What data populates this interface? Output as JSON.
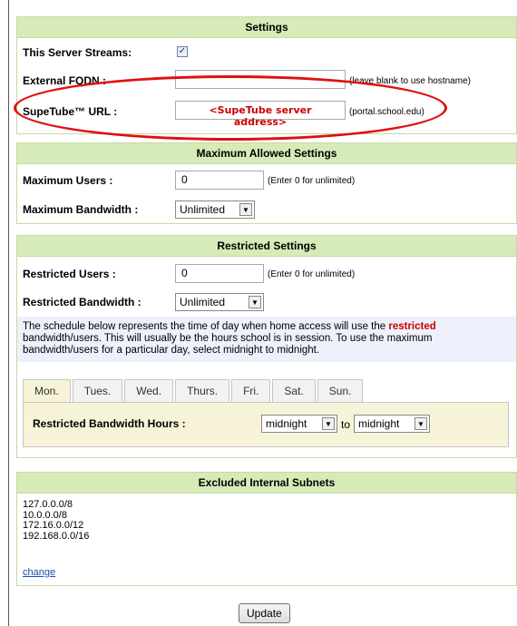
{
  "settings": {
    "header": "Settings",
    "streams_label": "This Server Streams:",
    "streams_checked": true,
    "fqdn_label": "External FQDN :",
    "fqdn_value": "",
    "fqdn_hint": "(leave blank to use hostname)",
    "url_label": "SupeTube™ URL :",
    "url_value": "<SupeTube server address>",
    "url_hint": "(portal.school.edu)"
  },
  "maximum": {
    "header": "Maximum Allowed Settings",
    "users_label": "Maximum Users :",
    "users_value": "0",
    "users_hint": "(Enter 0 for unlimited)",
    "bandwidth_label": "Maximum Bandwidth :",
    "bandwidth_value": "Unlimited"
  },
  "restricted": {
    "header": "Restricted Settings",
    "users_label": "Restricted Users :",
    "users_value": "0",
    "users_hint": "(Enter 0 for unlimited)",
    "bandwidth_label": "Restricted Bandwidth :",
    "bandwidth_value": "Unlimited",
    "note_before": "The schedule below represents the time of day when home access will use the ",
    "note_emph": "restricted",
    "note_after": " bandwidth/users. This will usually be the hours school is in session. To use the maximum bandwidth/users for a particular day, select midnight to midnight.",
    "tabs": [
      "Mon.",
      "Tues.",
      "Wed.",
      "Thurs.",
      "Fri.",
      "Sat.",
      "Sun."
    ],
    "active_tab": 0,
    "hours_label": "Restricted Bandwidth Hours :",
    "hours_from": "midnight",
    "hours_to_word": "to",
    "hours_to": "midnight"
  },
  "subnets": {
    "header": "Excluded Internal Subnets",
    "items": [
      "127.0.0.0/8",
      "10.0.0.0/8",
      "172.16.0.0/12",
      "192.168.0.0/16"
    ],
    "change_label": "change"
  },
  "update_label": "Update",
  "colors": {
    "header_bg": "#d6ebb8",
    "note_bg": "#eef1fb",
    "tab_panel_bg": "#f7f3d8",
    "highlight": "#e01010",
    "url_text": "#cc0000"
  }
}
